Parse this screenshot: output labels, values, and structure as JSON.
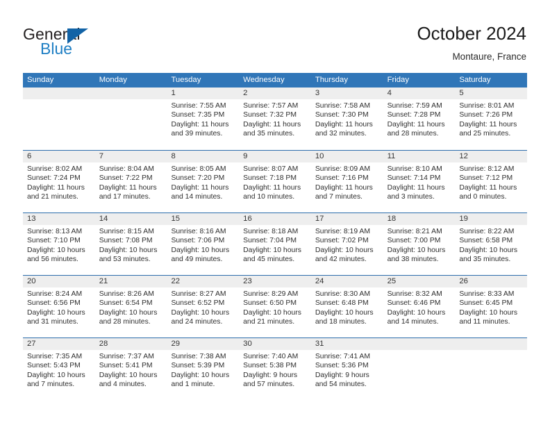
{
  "brand": {
    "word_top": "General",
    "word_bottom": "Blue",
    "flag_icon": "triangle-flag-icon"
  },
  "header": {
    "title": "October 2024",
    "subtitle": "Montaure, France"
  },
  "colors": {
    "header_blue": "#3076b8",
    "row_divider_blue": "#2b6cab",
    "daynum_band": "#eeeeee",
    "brand_blue": "#1f7fc4",
    "flag_blue": "#1263a6"
  },
  "weekdays": [
    "Sunday",
    "Monday",
    "Tuesday",
    "Wednesday",
    "Thursday",
    "Friday",
    "Saturday"
  ],
  "weeks": [
    [
      {
        "day": "",
        "lines": []
      },
      {
        "day": "",
        "lines": []
      },
      {
        "day": "1",
        "lines": [
          "Sunrise: 7:55 AM",
          "Sunset: 7:35 PM",
          "Daylight: 11 hours",
          "and 39 minutes."
        ]
      },
      {
        "day": "2",
        "lines": [
          "Sunrise: 7:57 AM",
          "Sunset: 7:32 PM",
          "Daylight: 11 hours",
          "and 35 minutes."
        ]
      },
      {
        "day": "3",
        "lines": [
          "Sunrise: 7:58 AM",
          "Sunset: 7:30 PM",
          "Daylight: 11 hours",
          "and 32 minutes."
        ]
      },
      {
        "day": "4",
        "lines": [
          "Sunrise: 7:59 AM",
          "Sunset: 7:28 PM",
          "Daylight: 11 hours",
          "and 28 minutes."
        ]
      },
      {
        "day": "5",
        "lines": [
          "Sunrise: 8:01 AM",
          "Sunset: 7:26 PM",
          "Daylight: 11 hours",
          "and 25 minutes."
        ]
      }
    ],
    [
      {
        "day": "6",
        "lines": [
          "Sunrise: 8:02 AM",
          "Sunset: 7:24 PM",
          "Daylight: 11 hours",
          "and 21 minutes."
        ]
      },
      {
        "day": "7",
        "lines": [
          "Sunrise: 8:04 AM",
          "Sunset: 7:22 PM",
          "Daylight: 11 hours",
          "and 17 minutes."
        ]
      },
      {
        "day": "8",
        "lines": [
          "Sunrise: 8:05 AM",
          "Sunset: 7:20 PM",
          "Daylight: 11 hours",
          "and 14 minutes."
        ]
      },
      {
        "day": "9",
        "lines": [
          "Sunrise: 8:07 AM",
          "Sunset: 7:18 PM",
          "Daylight: 11 hours",
          "and 10 minutes."
        ]
      },
      {
        "day": "10",
        "lines": [
          "Sunrise: 8:09 AM",
          "Sunset: 7:16 PM",
          "Daylight: 11 hours",
          "and 7 minutes."
        ]
      },
      {
        "day": "11",
        "lines": [
          "Sunrise: 8:10 AM",
          "Sunset: 7:14 PM",
          "Daylight: 11 hours",
          "and 3 minutes."
        ]
      },
      {
        "day": "12",
        "lines": [
          "Sunrise: 8:12 AM",
          "Sunset: 7:12 PM",
          "Daylight: 11 hours",
          "and 0 minutes."
        ]
      }
    ],
    [
      {
        "day": "13",
        "lines": [
          "Sunrise: 8:13 AM",
          "Sunset: 7:10 PM",
          "Daylight: 10 hours",
          "and 56 minutes."
        ]
      },
      {
        "day": "14",
        "lines": [
          "Sunrise: 8:15 AM",
          "Sunset: 7:08 PM",
          "Daylight: 10 hours",
          "and 53 minutes."
        ]
      },
      {
        "day": "15",
        "lines": [
          "Sunrise: 8:16 AM",
          "Sunset: 7:06 PM",
          "Daylight: 10 hours",
          "and 49 minutes."
        ]
      },
      {
        "day": "16",
        "lines": [
          "Sunrise: 8:18 AM",
          "Sunset: 7:04 PM",
          "Daylight: 10 hours",
          "and 45 minutes."
        ]
      },
      {
        "day": "17",
        "lines": [
          "Sunrise: 8:19 AM",
          "Sunset: 7:02 PM",
          "Daylight: 10 hours",
          "and 42 minutes."
        ]
      },
      {
        "day": "18",
        "lines": [
          "Sunrise: 8:21 AM",
          "Sunset: 7:00 PM",
          "Daylight: 10 hours",
          "and 38 minutes."
        ]
      },
      {
        "day": "19",
        "lines": [
          "Sunrise: 8:22 AM",
          "Sunset: 6:58 PM",
          "Daylight: 10 hours",
          "and 35 minutes."
        ]
      }
    ],
    [
      {
        "day": "20",
        "lines": [
          "Sunrise: 8:24 AM",
          "Sunset: 6:56 PM",
          "Daylight: 10 hours",
          "and 31 minutes."
        ]
      },
      {
        "day": "21",
        "lines": [
          "Sunrise: 8:26 AM",
          "Sunset: 6:54 PM",
          "Daylight: 10 hours",
          "and 28 minutes."
        ]
      },
      {
        "day": "22",
        "lines": [
          "Sunrise: 8:27 AM",
          "Sunset: 6:52 PM",
          "Daylight: 10 hours",
          "and 24 minutes."
        ]
      },
      {
        "day": "23",
        "lines": [
          "Sunrise: 8:29 AM",
          "Sunset: 6:50 PM",
          "Daylight: 10 hours",
          "and 21 minutes."
        ]
      },
      {
        "day": "24",
        "lines": [
          "Sunrise: 8:30 AM",
          "Sunset: 6:48 PM",
          "Daylight: 10 hours",
          "and 18 minutes."
        ]
      },
      {
        "day": "25",
        "lines": [
          "Sunrise: 8:32 AM",
          "Sunset: 6:46 PM",
          "Daylight: 10 hours",
          "and 14 minutes."
        ]
      },
      {
        "day": "26",
        "lines": [
          "Sunrise: 8:33 AM",
          "Sunset: 6:45 PM",
          "Daylight: 10 hours",
          "and 11 minutes."
        ]
      }
    ],
    [
      {
        "day": "27",
        "lines": [
          "Sunrise: 7:35 AM",
          "Sunset: 5:43 PM",
          "Daylight: 10 hours",
          "and 7 minutes."
        ]
      },
      {
        "day": "28",
        "lines": [
          "Sunrise: 7:37 AM",
          "Sunset: 5:41 PM",
          "Daylight: 10 hours",
          "and 4 minutes."
        ]
      },
      {
        "day": "29",
        "lines": [
          "Sunrise: 7:38 AM",
          "Sunset: 5:39 PM",
          "Daylight: 10 hours",
          "and 1 minute."
        ]
      },
      {
        "day": "30",
        "lines": [
          "Sunrise: 7:40 AM",
          "Sunset: 5:38 PM",
          "Daylight: 9 hours",
          "and 57 minutes."
        ]
      },
      {
        "day": "31",
        "lines": [
          "Sunrise: 7:41 AM",
          "Sunset: 5:36 PM",
          "Daylight: 9 hours",
          "and 54 minutes."
        ]
      },
      {
        "day": "",
        "lines": []
      },
      {
        "day": "",
        "lines": []
      }
    ]
  ]
}
